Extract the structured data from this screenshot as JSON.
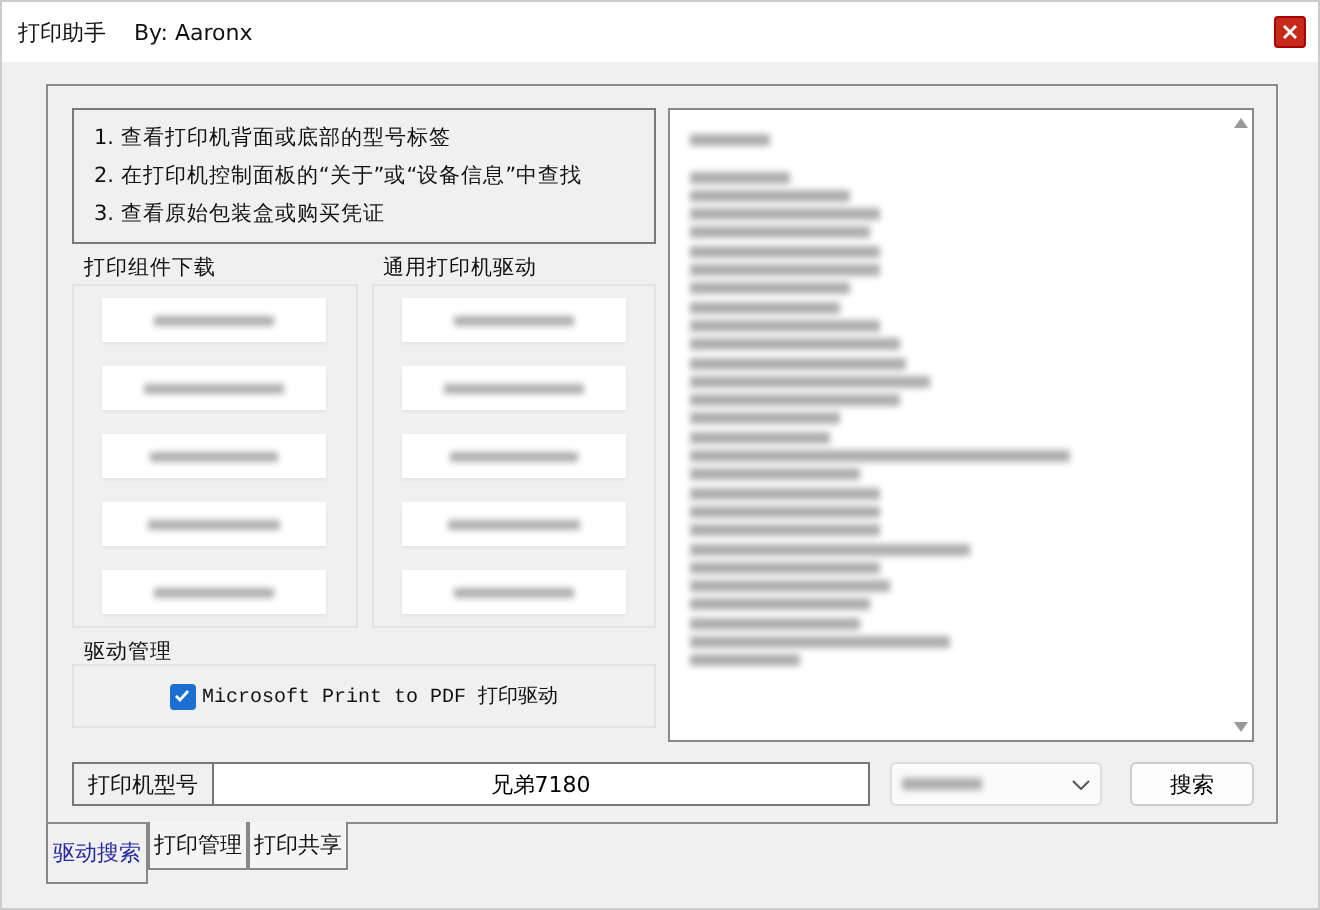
{
  "window": {
    "title": "打印助手",
    "author": "By: Aaronx"
  },
  "instructions": [
    "1. 查看打印机背面或底部的型号标签",
    "2. 在打印机控制面板的“关于”或“设备信息”中查找",
    "3. 查看原始包装盒或购买凭证"
  ],
  "component_group": {
    "title": "打印组件下载",
    "buttons": [
      {
        "kind": "blurred"
      },
      {
        "kind": "blurred"
      },
      {
        "kind": "blurred"
      },
      {
        "kind": "blurred"
      },
      {
        "kind": "blurred"
      }
    ]
  },
  "driver_group": {
    "title": "通用打印机驱动",
    "buttons": [
      {
        "kind": "blurred"
      },
      {
        "kind": "blurred"
      },
      {
        "kind": "blurred"
      },
      {
        "kind": "blurred"
      },
      {
        "kind": "blurred"
      }
    ]
  },
  "driver_management": {
    "title": "驱动管理",
    "items": [
      {
        "label": "Microsoft Print to PDF 打印驱动",
        "checked": true
      }
    ]
  },
  "list_box": {
    "kind": "blurred"
  },
  "search_row": {
    "label": "打印机型号",
    "value": "兄弟7180",
    "dropdown": {
      "kind": "blurred"
    },
    "button": "搜索"
  },
  "tabs": [
    {
      "label": "驱动搜索",
      "selected": true
    },
    {
      "label": "打印管理",
      "selected": false
    },
    {
      "label": "打印共享",
      "selected": false
    }
  ]
}
